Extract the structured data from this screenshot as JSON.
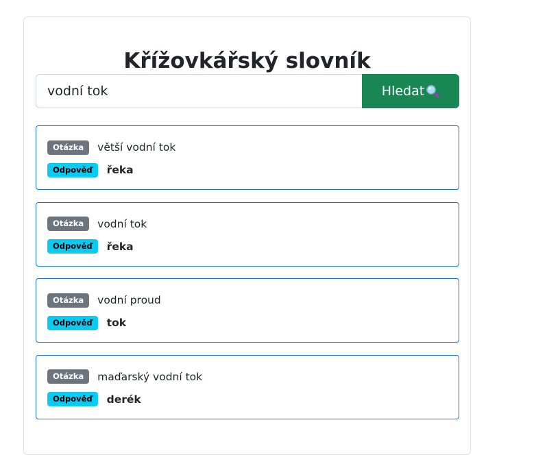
{
  "page": {
    "title": "Křížovkářský slovník"
  },
  "search": {
    "value": "vodní tok",
    "button_label": "Hledat",
    "button_icon": "magnifier-icon"
  },
  "labels": {
    "question": "Otázka",
    "answer": "Odpověď"
  },
  "results": [
    {
      "question": "větší vodní tok",
      "answer": "řeka"
    },
    {
      "question": "vodní tok",
      "answer": "řeka"
    },
    {
      "question": "vodní proud",
      "answer": "tok"
    },
    {
      "question": "maďarský vodní tok",
      "answer": "derék"
    }
  ],
  "colors": {
    "button": "#198754",
    "result_border": "#0d6efd",
    "question_badge": "#6c757d",
    "answer_badge": "#0dcaf0"
  }
}
